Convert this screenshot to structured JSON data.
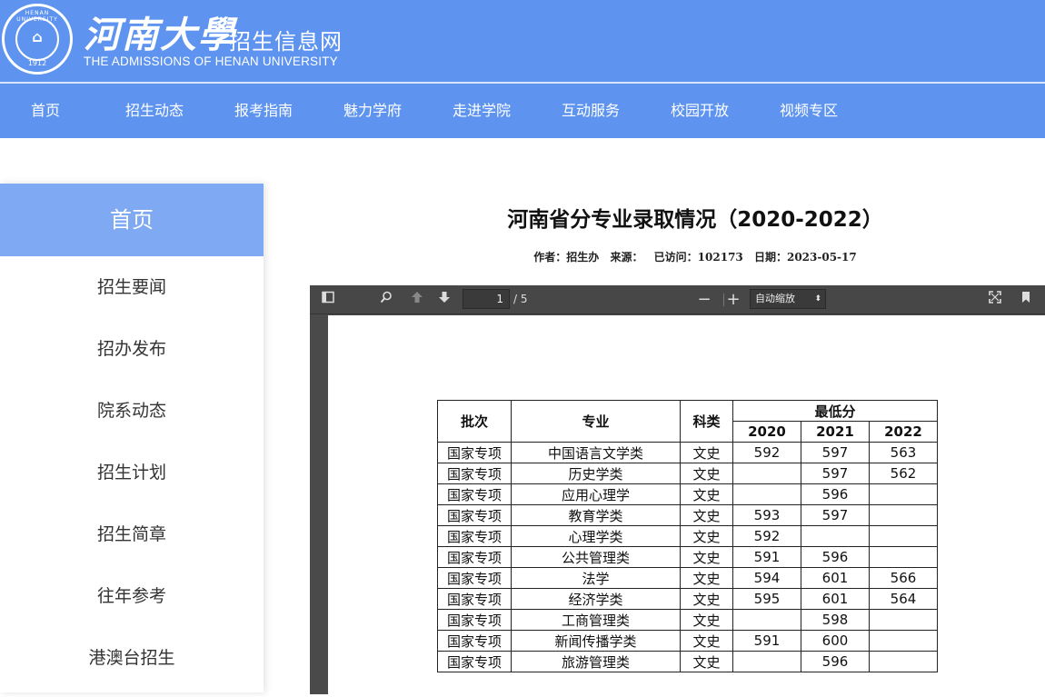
{
  "header": {
    "logo_cn": "河南大學",
    "logo_sub": "招生信息网",
    "logo_en": "THE ADMISSIONS OF HENAN UNIVERSITY",
    "seal_ring": "HENAN UNIVERSITY",
    "seal_year": "1912",
    "brand_color": "#5e94ef"
  },
  "nav": {
    "items": [
      "首页",
      "招生动态",
      "报考指南",
      "魅力学府",
      "走进学院",
      "互动服务",
      "校园开放",
      "视频专区"
    ]
  },
  "sidebar": {
    "header": "首页",
    "items": [
      "招生要闻",
      "招办发布",
      "院系动态",
      "招生计划",
      "招生简章",
      "往年参考",
      "港澳台招生"
    ]
  },
  "article": {
    "title": "河南省分专业录取情况（2020-2022）",
    "author": "作者：招生办",
    "source": "来源：",
    "visits": "已访问：102173",
    "date": "日期：2023-05-17"
  },
  "pdf": {
    "page_current": "1",
    "page_total": "/ 5",
    "zoom": "自动缩放",
    "icons": [
      "sidebar-toggle-icon",
      "search-icon",
      "prev-page-icon",
      "next-page-icon",
      "zoom-out-icon",
      "zoom-in-icon",
      "fullscreen-icon",
      "bookmark-icon"
    ]
  },
  "table": {
    "headers": {
      "batch": "批次",
      "major": "专业",
      "type": "科类",
      "min_score": "最低分",
      "years": [
        "2020",
        "2021",
        "2022"
      ]
    },
    "rows": [
      {
        "batch": "国家专项",
        "major": "中国语言文学类",
        "type": "文史",
        "s2020": "592",
        "s2021": "597",
        "s2022": "563"
      },
      {
        "batch": "国家专项",
        "major": "历史学类",
        "type": "文史",
        "s2020": "",
        "s2021": "597",
        "s2022": "562"
      },
      {
        "batch": "国家专项",
        "major": "应用心理学",
        "type": "文史",
        "s2020": "",
        "s2021": "596",
        "s2022": ""
      },
      {
        "batch": "国家专项",
        "major": "教育学类",
        "type": "文史",
        "s2020": "593",
        "s2021": "597",
        "s2022": ""
      },
      {
        "batch": "国家专项",
        "major": "心理学类",
        "type": "文史",
        "s2020": "592",
        "s2021": "",
        "s2022": ""
      },
      {
        "batch": "国家专项",
        "major": "公共管理类",
        "type": "文史",
        "s2020": "591",
        "s2021": "596",
        "s2022": ""
      },
      {
        "batch": "国家专项",
        "major": "法学",
        "type": "文史",
        "s2020": "594",
        "s2021": "601",
        "s2022": "566"
      },
      {
        "batch": "国家专项",
        "major": "经济学类",
        "type": "文史",
        "s2020": "595",
        "s2021": "601",
        "s2022": "564"
      },
      {
        "batch": "国家专项",
        "major": "工商管理类",
        "type": "文史",
        "s2020": "",
        "s2021": "598",
        "s2022": ""
      },
      {
        "batch": "国家专项",
        "major": "新闻传播学类",
        "type": "文史",
        "s2020": "591",
        "s2021": "600",
        "s2022": ""
      },
      {
        "batch": "国家专项",
        "major": "旅游管理类",
        "type": "文史",
        "s2020": "",
        "s2021": "596",
        "s2022": ""
      }
    ]
  }
}
